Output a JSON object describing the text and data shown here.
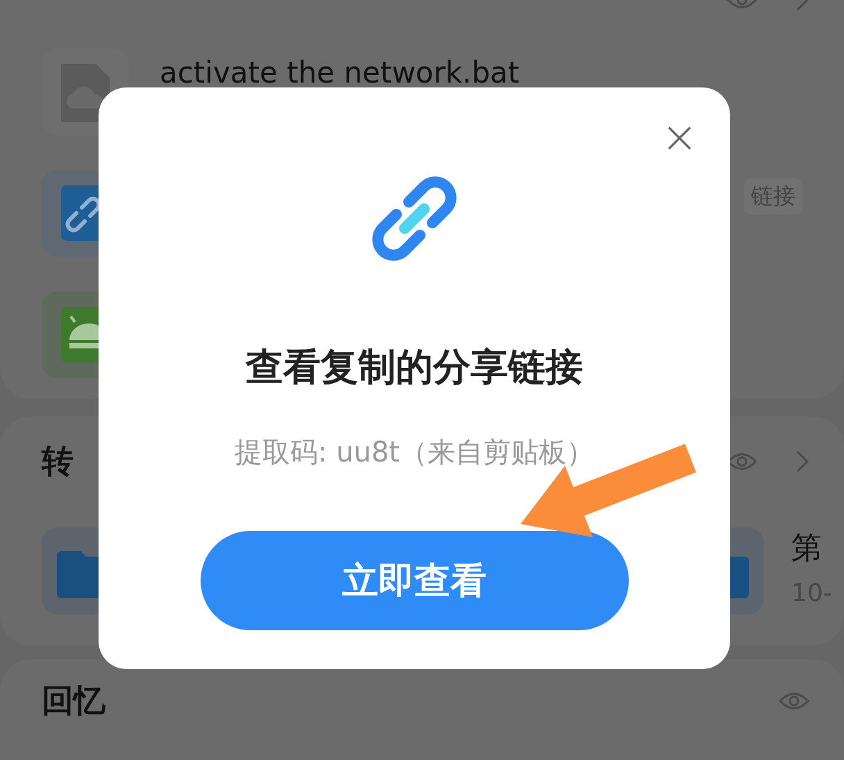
{
  "background": {
    "sections": [
      {
        "kind": "list",
        "eye": true,
        "chevron": true,
        "items": [
          {
            "kind": "file",
            "name": "activate the network.bat"
          },
          {
            "kind": "link",
            "tag": "链接"
          },
          {
            "kind": "android"
          }
        ]
      },
      {
        "kind": "grid",
        "title": "转",
        "eye": true,
        "chevron": true,
        "items": [
          {
            "kind": "folder"
          },
          {
            "kind": "folder",
            "name": "第",
            "date": "10-"
          }
        ]
      },
      {
        "kind": "plain",
        "title": "回忆",
        "eye": true,
        "chevron": false
      }
    ]
  },
  "dialog": {
    "title": "查看复制的分享链接",
    "subtitle": "提取码: uu8t（来自剪贴板）",
    "button": "立即查看"
  },
  "annotation": {
    "kind": "arrow"
  }
}
